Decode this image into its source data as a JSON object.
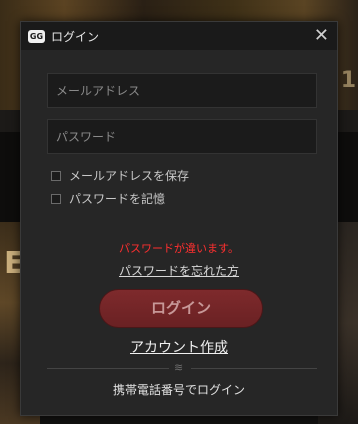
{
  "background": {
    "left_text": "EM",
    "right_text": "1"
  },
  "dialog": {
    "logo": "GG",
    "title": "ログイン",
    "close": "✕",
    "email_placeholder": "メールアドレス",
    "password_placeholder": "パスワード",
    "save_email_label": "メールアドレスを保存",
    "remember_password_label": "パスワードを記憶",
    "error_message": "パスワードが違います。",
    "forgot_password": "パスワードを忘れた方",
    "login_button": "ログイン",
    "create_account": "アカウント作成",
    "divider_icon": "≋",
    "phone_login": "携帯電話番号でログイン"
  },
  "colors": {
    "error": "#ff2f2f",
    "login_button": "#7e2a2c"
  }
}
